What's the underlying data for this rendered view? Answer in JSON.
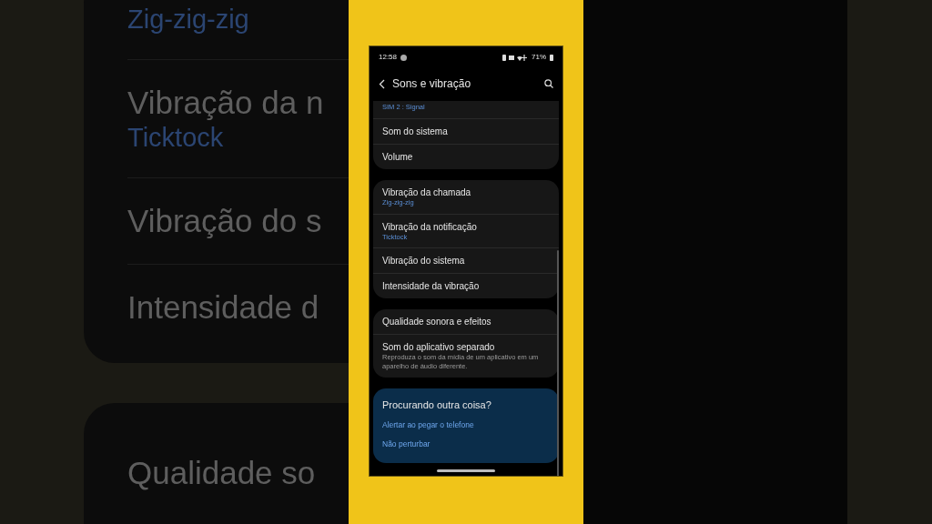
{
  "backdrop": {
    "groups": [
      {
        "items": [
          {
            "value": "Zig-zig-zig"
          },
          {
            "title": "Vibração da n",
            "value": "Ticktock"
          },
          {
            "title": "Vibração do s"
          },
          {
            "title": "Intensidade d"
          }
        ]
      },
      {
        "items": [
          {
            "title": "Qualidade so"
          }
        ]
      }
    ]
  },
  "phone": {
    "status_bar": {
      "time": "12:58",
      "battery": "71%"
    },
    "header": {
      "title": "Sons e vibração"
    },
    "groups": [
      {
        "items": [
          {
            "value": "SIM 2 : Signal"
          },
          {
            "title": "Som do sistema"
          },
          {
            "title": "Volume"
          }
        ]
      },
      {
        "items": [
          {
            "title": "Vibração da chamada",
            "value": "Zig-zig-zig"
          },
          {
            "title": "Vibração da notificação",
            "value": "Ticktock"
          },
          {
            "title": "Vibração do sistema"
          },
          {
            "title": "Intensidade da vibração"
          }
        ]
      },
      {
        "items": [
          {
            "title": "Qualidade sonora e efeitos"
          },
          {
            "title": "Som do aplicativo separado",
            "description": "Reproduza o som da mídia de um aplicativo em um aparelho de áudio diferente."
          }
        ]
      }
    ],
    "suggestions": {
      "title": "Procurando outra coisa?",
      "links": [
        "Alertar ao pegar o telefone",
        "Não perturbar"
      ]
    }
  }
}
